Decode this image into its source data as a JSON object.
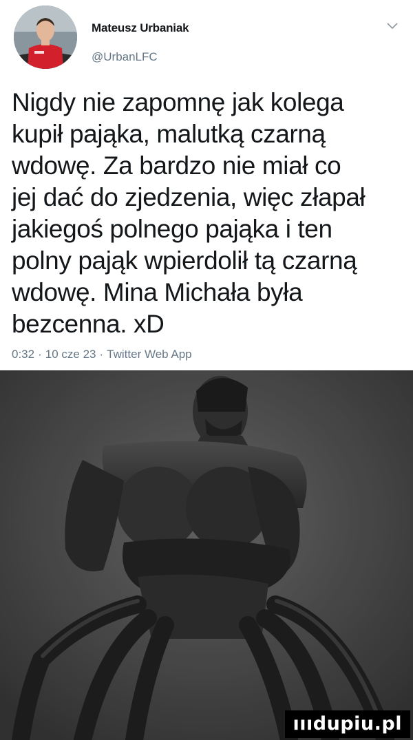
{
  "tweet": {
    "author_name": "Mateusz Urbaniak",
    "author_handle": "@UrbanLFC",
    "text": "Nigdy nie zapomnę jak kolega\nkupił pająka, malutką czarną\nwdowę. Za bardzo nie miał co\njej dać do zjedzenia, więc złapał\njakiegoś polnego pająka i ten\npolny pająk wpierdolił tą czarną\nwdowę. Mina Michała była\nbezcenna. xD",
    "time": "0:32",
    "date": "10 cze 23",
    "separator": "·",
    "app": "Twitter Web App",
    "menu_icon": "chevron-down-icon"
  },
  "image": {
    "description_icon": "meme-photo",
    "watermark": "ıııdupiu.pl"
  },
  "colors": {
    "text_primary": "#14171a",
    "text_secondary": "#657786",
    "background": "#ffffff",
    "watermark_bg": "#000000"
  }
}
